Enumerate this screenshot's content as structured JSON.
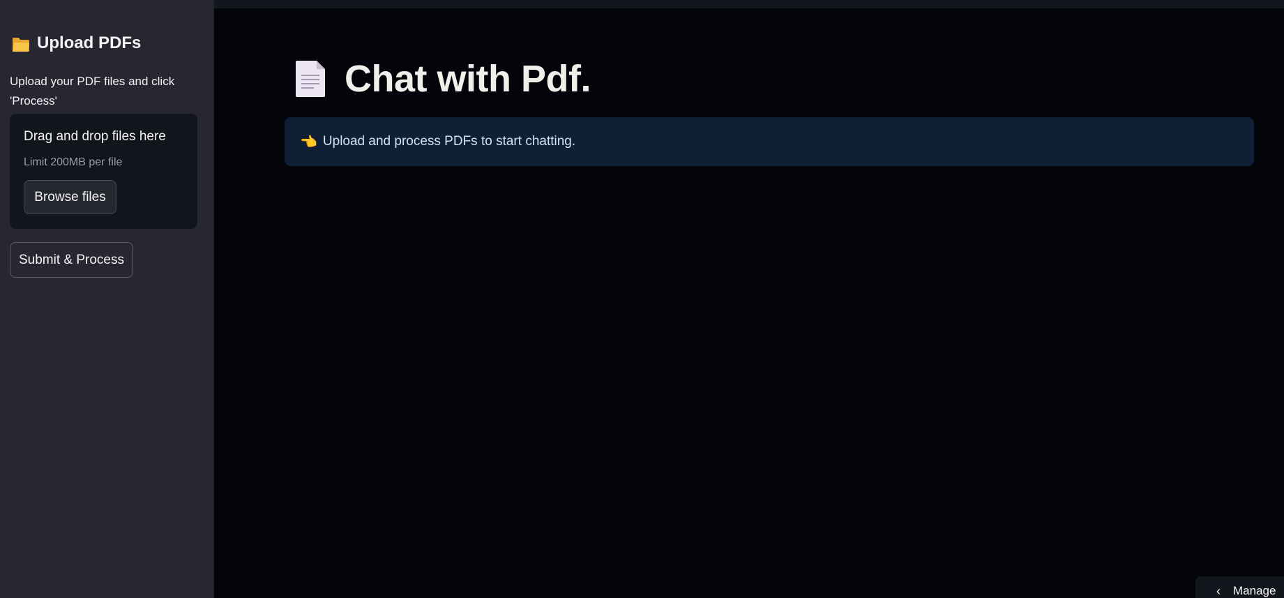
{
  "sidebar": {
    "title": "Upload PDFs",
    "description": "Upload your PDF files and click 'Process'",
    "dropzone": {
      "title": "Drag and drop files here",
      "limit": "Limit 200MB per file",
      "browse_label": "Browse files"
    },
    "submit_label": "Submit & Process",
    "icons": {
      "title": "folder-icon"
    }
  },
  "main": {
    "title": "Chat with Pdf.",
    "title_icon": "document-icon",
    "info": {
      "icon": "pointing-hand-icon",
      "text": "Upload and process PDFs to start chatting."
    }
  },
  "footer": {
    "manage_label": "Manage",
    "manage_icon": "chevron-left-icon"
  },
  "colors": {
    "background": "#03050a",
    "sidebar": "#272731",
    "info_box": "#0f2036",
    "info_text": "#cfe3f6"
  }
}
